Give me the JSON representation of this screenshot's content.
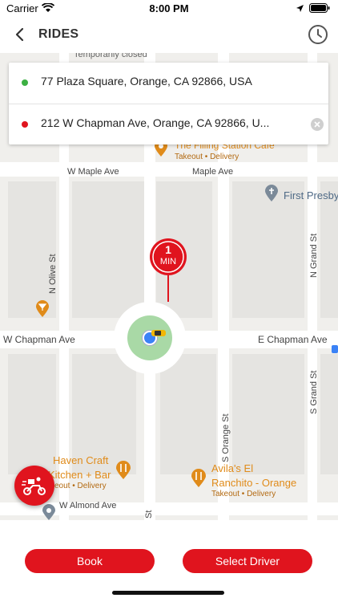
{
  "status_bar": {
    "carrier": "Carrier",
    "time": "8:00 PM"
  },
  "nav": {
    "title": "RIDES"
  },
  "addresses": {
    "pickup": "77 Plaza Square, Orange, CA 92866, USA",
    "dropoff": "212 W Chapman Ave, Orange, CA 92866, U..."
  },
  "map": {
    "eta_value": "1",
    "eta_unit": "MIN",
    "labels": {
      "temporarily_closed": "Temporarily closed",
      "w_maple_ave": "W Maple Ave",
      "maple_ave": "Maple Ave",
      "w_chapman_ave": "W Chapman Ave",
      "e_chapman_ave": "E Chapman Ave",
      "w_almond_ave": "W Almond Ave",
      "n_olive_st": "N Olive St",
      "n_grand_st": "N Grand St",
      "s_grand_st": "S Grand St",
      "s_orange_st": "S Orange St",
      "st": "St"
    },
    "pois": {
      "filling_station_name": "The Filling Station Cafe",
      "filling_station_sub": "Takeout • Delivery",
      "first_presby": "First Presby",
      "haven_name_1": "Haven Craft",
      "haven_name_2": "Kitchen + Bar",
      "haven_sub": "eout • Delivery",
      "avilas_name_1": "Avila's El",
      "avilas_name_2": "Ranchito - Orange",
      "avilas_sub": "Takeout • Delivery"
    }
  },
  "buttons": {
    "book": "Book",
    "select_driver": "Select Driver"
  },
  "colors": {
    "accent": "#e0141e",
    "pickup_dot": "#3cb043",
    "dropoff_dot": "#e0141e",
    "poi": "#e08b1a"
  }
}
